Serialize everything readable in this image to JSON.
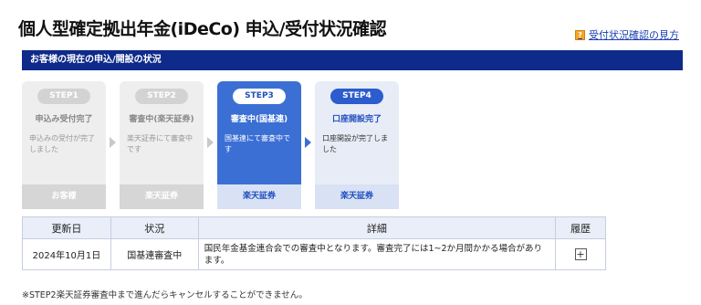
{
  "page": {
    "title": "個人型確定拠出年金(iDeCo) 申込/受付状況確認",
    "help_link": "受付状況確認の見方",
    "help_icon": "question-icon"
  },
  "section": {
    "heading": "お客様の現在の申込/開設の状況"
  },
  "steps": [
    {
      "pill": "STEP1",
      "title": "申込み受付完了",
      "desc": "申込みの受付が完了しました",
      "foot": "お客様",
      "state": "done"
    },
    {
      "pill": "STEP2",
      "title": "審査中(楽天証券)",
      "desc": "楽天証券にて審査中です",
      "foot": "楽天証券",
      "state": "done"
    },
    {
      "pill": "STEP3",
      "title": "審査中(国基連)",
      "desc": "国基連にて審査中です",
      "foot": "楽天証券",
      "state": "current"
    },
    {
      "pill": "STEP4",
      "title": "口座開設完了",
      "desc": "口座開設が完了しました",
      "foot": "楽天証券",
      "state": "upcoming"
    }
  ],
  "table": {
    "headers": [
      "更新日",
      "状況",
      "詳細",
      "履歴"
    ],
    "rows": [
      {
        "date": "2024年10月1日",
        "status": "国基連審査中",
        "detail": "国民年金基金連合会での審査中となります。審査完了には1~2か月間かかる場合があります。",
        "history_icon": "plus-icon",
        "history_symbol": "+"
      }
    ]
  },
  "footnote": "※STEP2楽天証券審査中まで進んだらキャンセルすることができません。",
  "colors": {
    "header_bar": "#0e2a8a",
    "active_step": "#3b6fd4",
    "link": "#1a3fb0"
  }
}
